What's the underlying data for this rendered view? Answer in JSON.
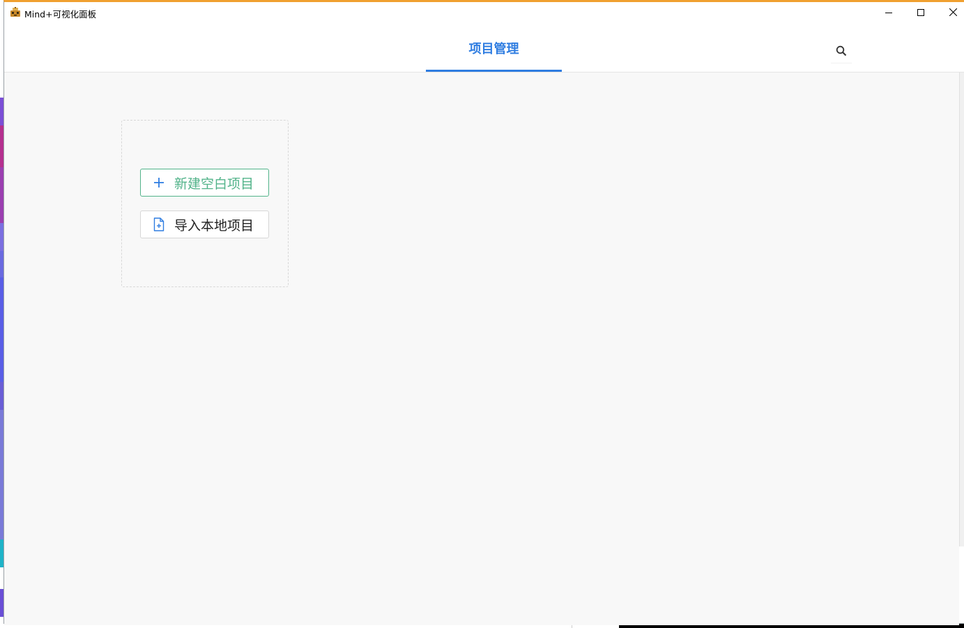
{
  "window": {
    "title": "Mind+可视化面板",
    "minimize_icon": "minimize-icon",
    "maximize_icon": "maximize-icon",
    "close_icon": "close-icon"
  },
  "header": {
    "tabs": [
      {
        "label": "项目管理",
        "active": true
      }
    ],
    "search_icon": "search-icon",
    "accent_color": "#2f7de1"
  },
  "main": {
    "actions": {
      "new_project_label": "新建空白项目",
      "new_project_icon": "plus-icon",
      "new_project_color": "#52b38a",
      "import_project_label": "导入本地项目",
      "import_project_icon": "file-add-icon"
    }
  }
}
